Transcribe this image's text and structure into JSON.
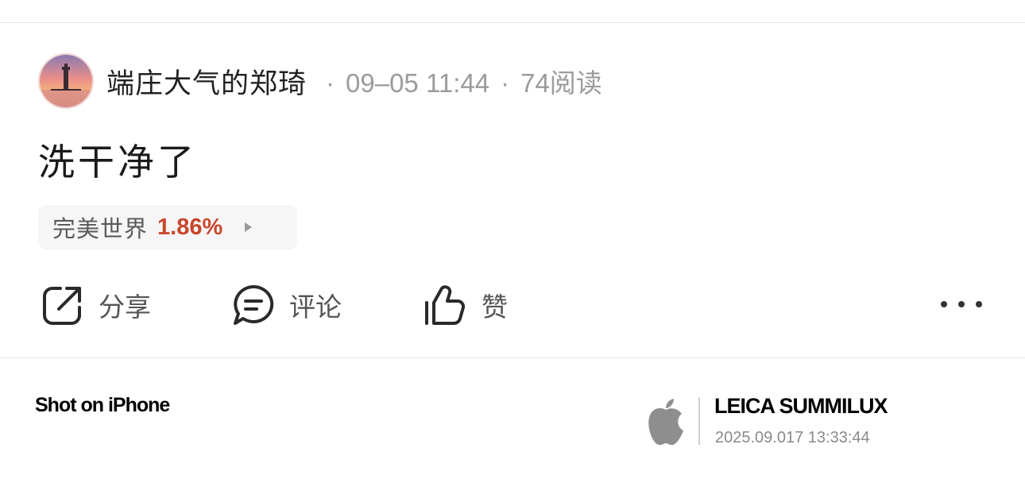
{
  "post": {
    "author": "端庄大气的郑琦",
    "meta_separator": "·",
    "timestamp": "09–05 11:44",
    "read_count": "74阅读",
    "text": "洗干净了"
  },
  "stock_chip": {
    "name": "完美世界",
    "change": "1.86%",
    "change_color": "#c9462a",
    "arrow_icon": "triangle-right-icon"
  },
  "actions": {
    "share": {
      "label": "分享",
      "icon": "share-icon"
    },
    "comment": {
      "label": "评论",
      "icon": "comment-icon"
    },
    "like": {
      "label": "赞",
      "icon": "thumbs-up-icon"
    },
    "more_icon": "more-dots-icon"
  },
  "watermark": {
    "shot_on": "Shot on iPhone",
    "logo": "apple-logo",
    "lens": "LEICA SUMMILUX",
    "datetime": "2025.09.017 13:33:44"
  }
}
